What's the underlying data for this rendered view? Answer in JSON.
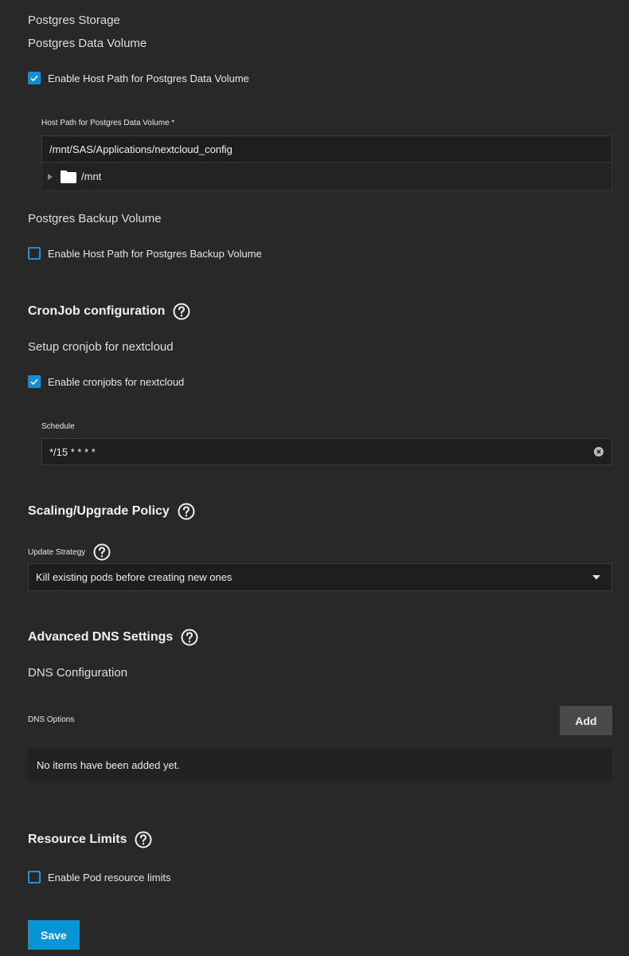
{
  "postgres": {
    "storage_heading": "Postgres Storage",
    "data_volume_heading": "Postgres Data Volume",
    "data_volume_checkbox_label": "Enable Host Path for Postgres Data Volume",
    "data_volume_checked": true,
    "host_path_label": "Host Path for Postgres Data Volume *",
    "host_path_value": "/mnt/SAS/Applications/nextcloud_config",
    "tree_root_label": "/mnt",
    "backup_volume_heading": "Postgres Backup Volume",
    "backup_volume_checkbox_label": "Enable Host Path for Postgres Backup Volume",
    "backup_volume_checked": false
  },
  "cronjob": {
    "title": "CronJob configuration",
    "subheading": "Setup cronjob for nextcloud",
    "checkbox_label": "Enable cronjobs for nextcloud",
    "checked": true,
    "schedule_label": "Schedule",
    "schedule_value": "*/15 * * * *"
  },
  "scaling": {
    "title": "Scaling/Upgrade Policy",
    "update_strategy_label": "Update Strategy",
    "update_strategy_value": "Kill existing pods before creating new ones"
  },
  "dns": {
    "title": "Advanced DNS Settings",
    "subheading": "DNS Configuration",
    "options_label": "DNS Options",
    "add_button_label": "Add",
    "empty_message": "No items have been added yet."
  },
  "resources": {
    "title": "Resource Limits",
    "checkbox_label": "Enable Pod resource limits",
    "checked": false
  },
  "footer": {
    "save_label": "Save"
  },
  "colors": {
    "accent": "#0895d6",
    "background": "#282828"
  },
  "icons": [
    "help-icon",
    "check-icon",
    "folder-icon",
    "caret-right-icon",
    "clear-icon",
    "dropdown-arrow-icon"
  ]
}
